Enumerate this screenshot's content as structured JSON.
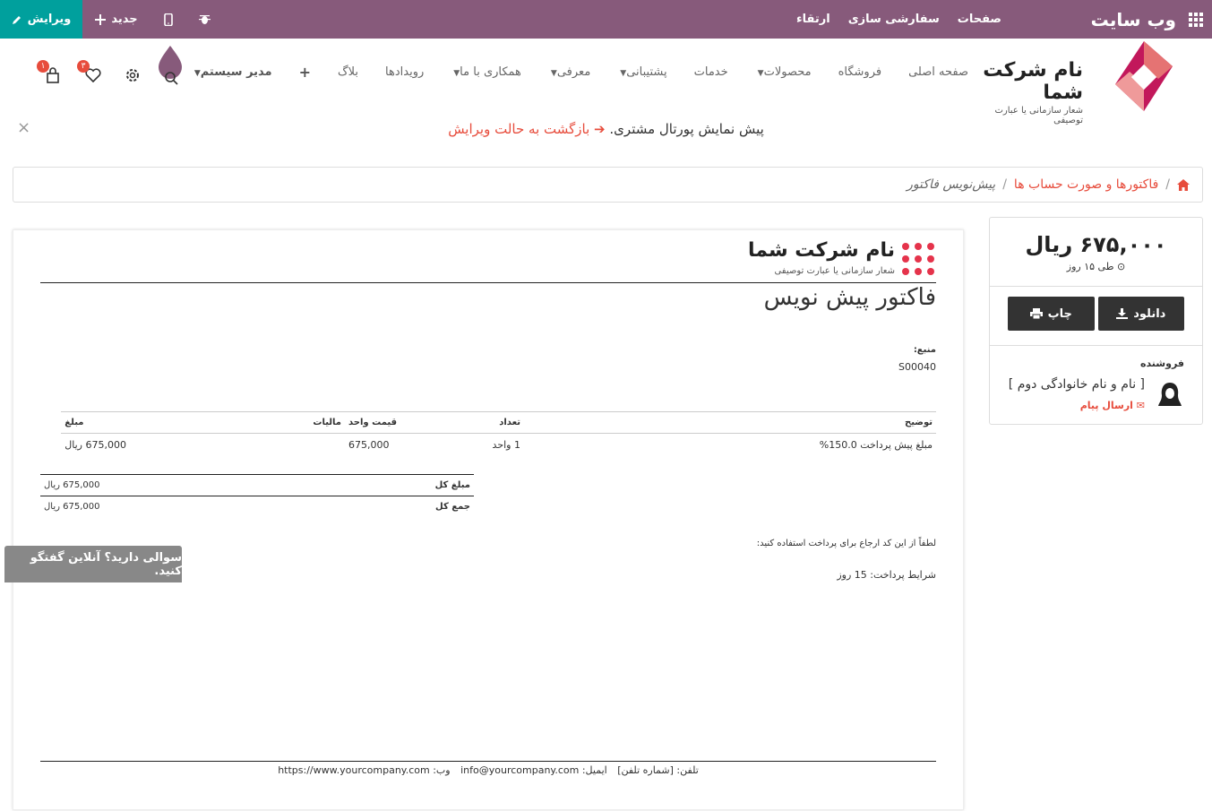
{
  "topbar": {
    "brand": "وب سایت",
    "menu": [
      "صفحات",
      "سفارشی سازی",
      "ارتقاء"
    ],
    "edit_label": "ویرایش",
    "new_label": "جدید",
    "bg": "#875a7b",
    "accent": "#00a09d"
  },
  "navbar": {
    "logo_title": "نام شرکت شما",
    "logo_sub": "شعار سازمانی یا عبارت توصیفی",
    "items": [
      {
        "label": "صفحه اصلی",
        "dropdown": false
      },
      {
        "label": "فروشگاه",
        "dropdown": false
      },
      {
        "label": "محصولات",
        "dropdown": true
      },
      {
        "label": "خدمات",
        "dropdown": false
      },
      {
        "label": "پشتیبانی",
        "dropdown": true
      },
      {
        "label": "معرفی",
        "dropdown": true
      },
      {
        "label": "همکاری با ما",
        "dropdown": true
      },
      {
        "label": "رویدادها",
        "dropdown": false
      },
      {
        "label": "بلاگ",
        "dropdown": false
      }
    ],
    "plus": "+",
    "admin": "مدیر سیستم",
    "wishlist_count": "۳",
    "cart_count": "۱"
  },
  "banner": {
    "preview": "پیش نمایش پورتال مشتری.",
    "back": "بازگشت به حالت ویرایش",
    "close": "×"
  },
  "breadcrumb": {
    "invoices": "فاکتورها و صورت حساب ها",
    "current": "پیش‌نویس فاکتور",
    "sep": "/"
  },
  "doc": {
    "logo_title": "نام شرکت شما",
    "logo_sub": "شعار سازمانی یا عبارت توصیفی",
    "title": "فاکتور پیش نویس",
    "source_label": "منبع:",
    "source_value": "S00040",
    "columns": [
      "توضیح",
      "تعداد",
      "قیمت واحد",
      "مالیات",
      "مبلغ"
    ],
    "rows": [
      {
        "desc": "مبلغ پیش پرداخت 150.0%",
        "qty": "1 واحد",
        "unit": "675,000",
        "tax": "",
        "amount": "675,000 ریال"
      }
    ],
    "subtotal_label": "مبلغ کل",
    "subtotal_value": "675,000 ریال",
    "total_label": "جمع کل",
    "total_value": "675,000 ریال",
    "note_ref": "لطفاً از این کد ارجاع برای پرداخت استفاده کنید:",
    "note_terms": "شرایط پرداخت: 15 روز",
    "footer_phone": "تلفن: [شماره تلفن]",
    "footer_email": "ایمیل: info@yourcompany.com",
    "footer_web": "وب: https://www.yourcompany.com"
  },
  "side": {
    "amount": "۶۷۵,۰۰۰ ریال",
    "due": "طی ۱۵ روز",
    "download": "دانلود",
    "print": "چاپ",
    "seller_label": "فروشنده",
    "seller_name": "[ نام و نام خانوادگی دوم ]",
    "send_msg": "ارسال پیام"
  },
  "chat": {
    "label": "سوالی دارید؟ آنلاین گفتگو کنید."
  }
}
